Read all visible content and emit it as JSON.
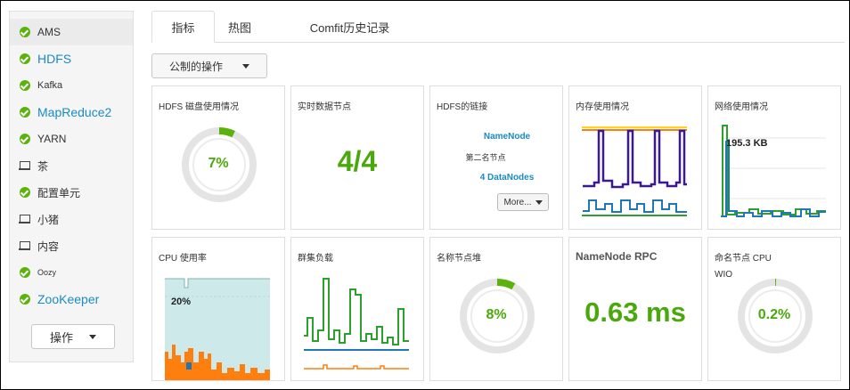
{
  "sidebar": {
    "services": [
      {
        "label": "AMS",
        "icon": "check-circle-icon",
        "status": "ok",
        "style": "normal",
        "active": true
      },
      {
        "label": "HDFS",
        "icon": "check-circle-icon",
        "status": "ok",
        "style": "link"
      },
      {
        "label": "Kafka",
        "icon": "check-circle-icon",
        "status": "ok",
        "style": "small"
      },
      {
        "label": "MapReduce2",
        "icon": "check-circle-icon",
        "status": "ok",
        "style": "link"
      },
      {
        "label": "YARN",
        "icon": "check-circle-icon",
        "status": "ok",
        "style": "normal"
      },
      {
        "label": "茶",
        "icon": "laptop-icon",
        "status": "client",
        "style": "normal"
      },
      {
        "label": "配置单元",
        "icon": "check-circle-icon",
        "status": "ok",
        "style": "normal"
      },
      {
        "label": "小猪",
        "icon": "laptop-icon",
        "status": "client",
        "style": "normal"
      },
      {
        "label": "内容",
        "icon": "laptop-icon",
        "status": "client",
        "style": "normal"
      },
      {
        "label": "Oozy",
        "icon": "check-circle-icon",
        "status": "ok",
        "style": "tiny"
      },
      {
        "label": "ZooKeeper",
        "icon": "check-circle-icon",
        "status": "ok",
        "style": "link"
      }
    ],
    "actions_label": "操作"
  },
  "tabs": [
    {
      "label": "指标",
      "active": true
    },
    {
      "label": "热图",
      "active": false
    },
    {
      "label": "Comfit历史记录",
      "active": false
    }
  ],
  "shared_actions_label": "公制的操作",
  "widgets": {
    "hdfs_disk": {
      "title": "HDFS 磁盘使用情况",
      "value": "7%",
      "fraction": 0.07
    },
    "live_datanodes": {
      "title": "实时数据节点",
      "value": "4/4"
    },
    "hdfs_links": {
      "title": "HDFS的链接",
      "namenode": "NameNode",
      "secondary": "第二名节点",
      "datanodes": "4 DataNodes",
      "more_label": "More..."
    },
    "memory": {
      "title": "内存使用情况"
    },
    "network": {
      "title": "网络使用情况",
      "label": "195.3 KB"
    },
    "cpu": {
      "title": "CPU 使用率",
      "label": "20%"
    },
    "cluster_load": {
      "title": "群集负载"
    },
    "namenode_heap": {
      "title": "名称节点堆",
      "value": "8%",
      "fraction": 0.08
    },
    "namenode_rpc": {
      "title": "NameNode RPC",
      "value": "0.63 ms"
    },
    "namenode_cpu": {
      "title": "命名节点 CPU",
      "subtitle": "WIO",
      "value": "0.2%",
      "fraction": 0.002
    }
  },
  "colors": {
    "accent_green": "#5cb20c",
    "link_blue": "#1a8bc4",
    "series_purple": "#3d1a8c",
    "series_blue": "#1f77b4",
    "series_green": "#2ca02c",
    "series_orange": "#ff7f0e",
    "series_yellow": "#ffd21f",
    "cpu_area": "#cde9ea"
  }
}
